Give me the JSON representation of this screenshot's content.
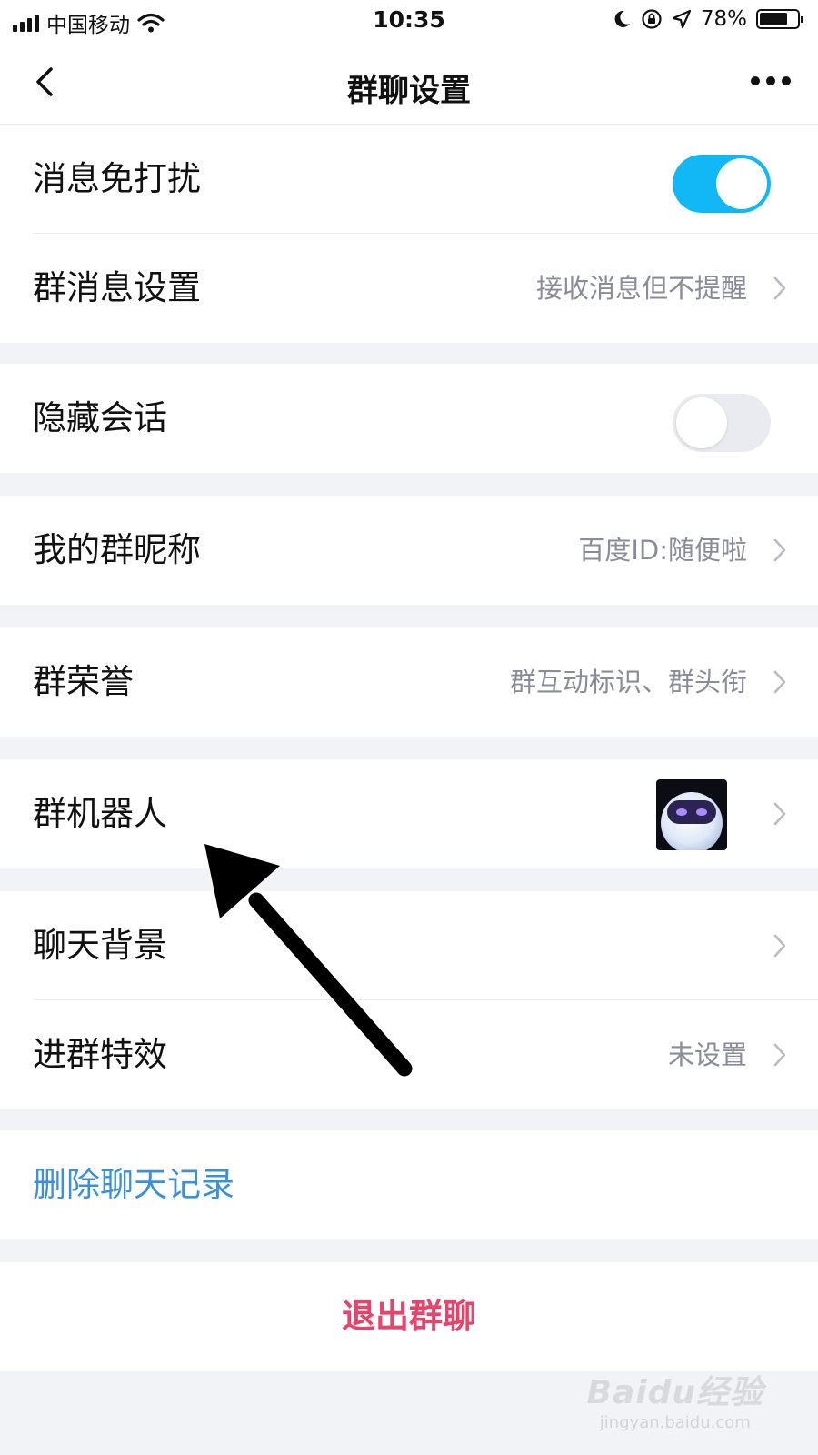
{
  "status_bar": {
    "carrier": "中国移动",
    "time": "10:35",
    "battery_text": "78%",
    "battery_level": 0.78
  },
  "nav": {
    "title": "群聊设置"
  },
  "rows": {
    "mute": {
      "label": "消息免打扰",
      "toggle_on": true
    },
    "group_msg_settings": {
      "label": "群消息设置",
      "value": "接收消息但不提醒"
    },
    "hide_chat": {
      "label": "隐藏会话",
      "toggle_on": false
    },
    "my_nickname": {
      "label": "我的群昵称",
      "value": "百度ID:随便啦"
    },
    "group_honor": {
      "label": "群荣誉",
      "value": "群互动标识、群头衔"
    },
    "group_robot": {
      "label": "群机器人"
    },
    "chat_background": {
      "label": "聊天背景"
    },
    "join_effect": {
      "label": "进群特效",
      "value": "未设置"
    }
  },
  "actions": {
    "delete_history": "删除聊天记录",
    "exit_group": "退出群聊"
  },
  "watermark": {
    "main": "Baidu经验",
    "sub": "jingyan.baidu.com"
  },
  "colors": {
    "toggle_on": "#12b7f5",
    "link_blue": "#3d8fd9",
    "danger_red": "#e8436a",
    "page_bg": "#f2f3f6"
  },
  "icons": [
    "back-chevron-icon",
    "more-dots-icon",
    "chevron-right-icon",
    "robot-avatar-icon",
    "annotation-arrow"
  ]
}
